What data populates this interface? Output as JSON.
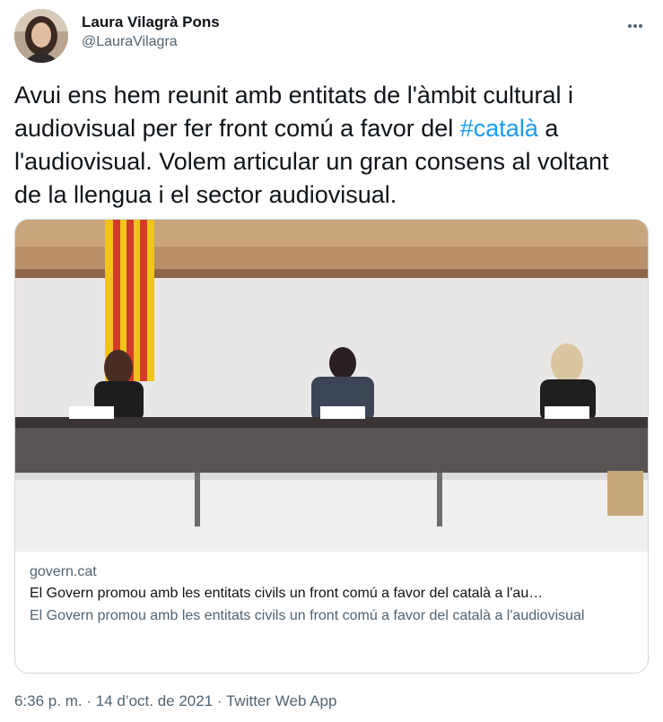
{
  "author": {
    "display_name": "Laura Vilagrà Pons",
    "handle": "@LauraVilagra"
  },
  "tweet": {
    "text_before": "Avui ens hem reunit amb entitats de l'àmbit cultural i audiovisual per fer front comú a favor del ",
    "hashtag": "#català",
    "text_after": " a l'audiovisual. Volem articular un gran consens al voltant de la llengua i el sector audiovisual."
  },
  "card": {
    "domain": "govern.cat",
    "title": "El Govern promou amb les entitats civils un front comú a favor del català a l'au…",
    "description": "El Govern promou amb les entitats civils un front comú a favor del català a l'audiovisual"
  },
  "footer": {
    "time": "6:36 p. m.",
    "separator1": " · ",
    "date": "14 d’oct. de 2021",
    "separator2": " · ",
    "app": "Twitter Web App"
  },
  "colors": {
    "link": "#1d9bf0",
    "secondary_text": "#536471",
    "border": "#cfd9de"
  },
  "icons": {
    "more": "more-icon"
  }
}
